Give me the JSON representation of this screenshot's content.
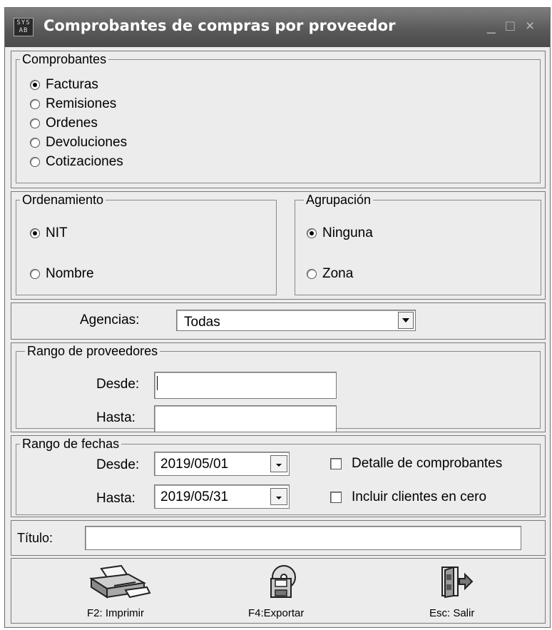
{
  "window": {
    "title": "Comprobantes de compras por proveedor",
    "icon_text": "SYS\nAB"
  },
  "comprobantes": {
    "legend": "Comprobantes",
    "options": [
      {
        "label": "Facturas",
        "checked": true
      },
      {
        "label": "Remisiones",
        "checked": false
      },
      {
        "label": "Ordenes",
        "checked": false
      },
      {
        "label": "Devoluciones",
        "checked": false
      },
      {
        "label": "Cotizaciones",
        "checked": false
      }
    ]
  },
  "ordenamiento": {
    "legend": "Ordenamiento",
    "options": [
      {
        "label": "NIT",
        "checked": true
      },
      {
        "label": "Nombre",
        "checked": false
      }
    ]
  },
  "agrupacion": {
    "legend": "Agrupación",
    "options": [
      {
        "label": "Ninguna",
        "checked": true
      },
      {
        "label": "Zona",
        "checked": false
      }
    ]
  },
  "agencias": {
    "label": "Agencias:",
    "value": "Todas"
  },
  "rango_proveedores": {
    "legend": "Rango de proveedores",
    "desde_label": "Desde:",
    "desde_value": "",
    "hasta_label": "Hasta:",
    "hasta_value": ""
  },
  "rango_fechas": {
    "legend": "Rango de fechas",
    "desde_label": "Desde:",
    "desde_value": "2019/05/01",
    "hasta_label": "Hasta:",
    "hasta_value": "2019/05/31"
  },
  "options": {
    "detalle_label": "Detalle de comprobantes",
    "detalle_checked": false,
    "incluir_label": "Incluir clientes en cero",
    "incluir_checked": false
  },
  "titulo": {
    "label": "Título:",
    "value": ""
  },
  "toolbar": {
    "print_label": "F2: Imprimir",
    "export_label": "F4:Exportar",
    "exit_label": "Esc: Salir"
  }
}
